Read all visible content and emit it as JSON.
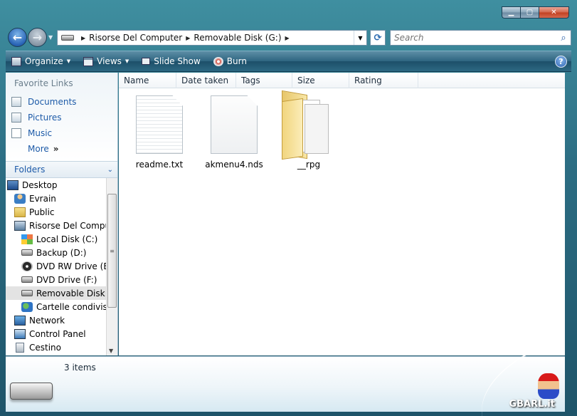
{
  "window": {
    "caption": {
      "min": "▁",
      "max": "▢",
      "close": "✕"
    }
  },
  "nav": {
    "back_glyph": "←",
    "forward_glyph": "→",
    "dropdown_glyph": "▼",
    "breadcrumbs": [
      "Risorse Del Computer",
      "Removable Disk (G:)"
    ],
    "crumb_separator": "▶",
    "refresh_glyph": "⟳",
    "search": {
      "placeholder": "Search",
      "icon": "search-icon"
    }
  },
  "toolbar": {
    "organize": "Organize",
    "views": "Views",
    "slideshow": "Slide Show",
    "burn": "Burn",
    "caret": "▼",
    "help": "?"
  },
  "navpane": {
    "favorites_title": "Favorite Links",
    "favorites": [
      {
        "label": "Documents",
        "icon": "documents-icon"
      },
      {
        "label": "Pictures",
        "icon": "pictures-icon"
      },
      {
        "label": "Music",
        "icon": "music-icon"
      },
      {
        "label": "More",
        "icon": ""
      }
    ],
    "more_arrow": "»",
    "folders_title": "Folders",
    "folders_chevron": "⌄",
    "tree": [
      {
        "label": "Desktop",
        "indent": 0,
        "icon": "desktop-icon"
      },
      {
        "label": "Evrain",
        "indent": 1,
        "icon": "user-folder-icon"
      },
      {
        "label": "Public",
        "indent": 1,
        "icon": "folder-icon"
      },
      {
        "label": "Risorse Del Computer",
        "indent": 1,
        "icon": "computer-icon"
      },
      {
        "label": "Local Disk (C:)",
        "indent": 2,
        "icon": "windows-drive-icon"
      },
      {
        "label": "Backup (D:)",
        "indent": 2,
        "icon": "drive-icon"
      },
      {
        "label": "DVD RW Drive (E:)",
        "indent": 2,
        "icon": "dvd-icon"
      },
      {
        "label": "DVD Drive (F:)",
        "indent": 2,
        "icon": "dvd-drive-icon"
      },
      {
        "label": "Removable Disk (G:)",
        "indent": 2,
        "icon": "removable-disk-icon",
        "selected": true
      },
      {
        "label": "Cartelle condivise",
        "indent": 2,
        "icon": "shared-folders-icon"
      },
      {
        "label": "Network",
        "indent": 1,
        "icon": "network-icon"
      },
      {
        "label": "Control Panel",
        "indent": 1,
        "icon": "control-panel-icon"
      },
      {
        "label": "Cestino",
        "indent": 1,
        "icon": "recycle-bin-icon"
      }
    ],
    "scroll_grip": "≡",
    "scroll_down": "▼"
  },
  "columns": [
    "Name",
    "Date taken",
    "Tags",
    "Size",
    "Rating"
  ],
  "files": [
    {
      "name": "readme.txt",
      "kind": "text-document-icon"
    },
    {
      "name": "akmenu4.nds",
      "kind": "generic-file-icon"
    },
    {
      "name": "__rpg",
      "kind": "folder-icon"
    }
  ],
  "details": {
    "count": "3 items",
    "watermark": "GBARL.it"
  }
}
